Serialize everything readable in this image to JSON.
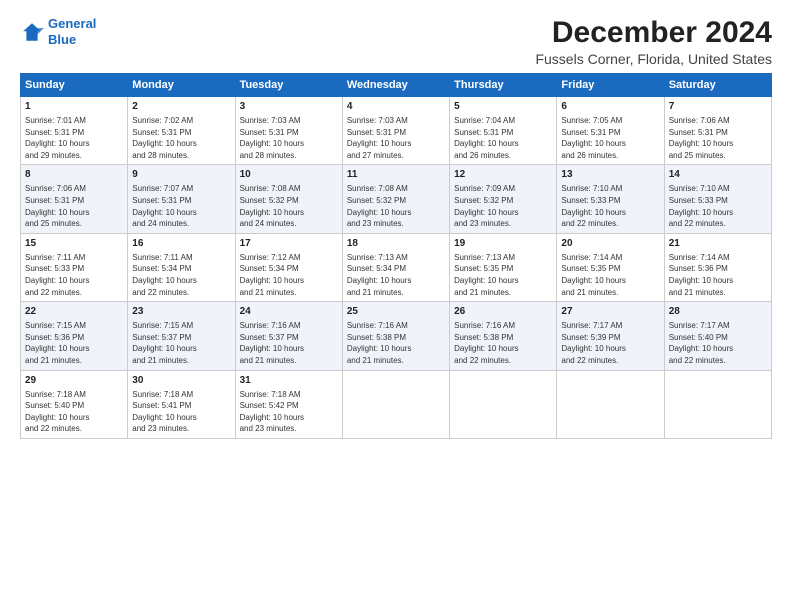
{
  "logo": {
    "line1": "General",
    "line2": "Blue"
  },
  "title": "December 2024",
  "subtitle": "Fussels Corner, Florida, United States",
  "days_header": [
    "Sunday",
    "Monday",
    "Tuesday",
    "Wednesday",
    "Thursday",
    "Friday",
    "Saturday"
  ],
  "weeks": [
    [
      {
        "day": "1",
        "text": "Sunrise: 7:01 AM\nSunset: 5:31 PM\nDaylight: 10 hours\nand 29 minutes."
      },
      {
        "day": "2",
        "text": "Sunrise: 7:02 AM\nSunset: 5:31 PM\nDaylight: 10 hours\nand 28 minutes."
      },
      {
        "day": "3",
        "text": "Sunrise: 7:03 AM\nSunset: 5:31 PM\nDaylight: 10 hours\nand 28 minutes."
      },
      {
        "day": "4",
        "text": "Sunrise: 7:03 AM\nSunset: 5:31 PM\nDaylight: 10 hours\nand 27 minutes."
      },
      {
        "day": "5",
        "text": "Sunrise: 7:04 AM\nSunset: 5:31 PM\nDaylight: 10 hours\nand 26 minutes."
      },
      {
        "day": "6",
        "text": "Sunrise: 7:05 AM\nSunset: 5:31 PM\nDaylight: 10 hours\nand 26 minutes."
      },
      {
        "day": "7",
        "text": "Sunrise: 7:06 AM\nSunset: 5:31 PM\nDaylight: 10 hours\nand 25 minutes."
      }
    ],
    [
      {
        "day": "8",
        "text": "Sunrise: 7:06 AM\nSunset: 5:31 PM\nDaylight: 10 hours\nand 25 minutes."
      },
      {
        "day": "9",
        "text": "Sunrise: 7:07 AM\nSunset: 5:31 PM\nDaylight: 10 hours\nand 24 minutes."
      },
      {
        "day": "10",
        "text": "Sunrise: 7:08 AM\nSunset: 5:32 PM\nDaylight: 10 hours\nand 24 minutes."
      },
      {
        "day": "11",
        "text": "Sunrise: 7:08 AM\nSunset: 5:32 PM\nDaylight: 10 hours\nand 23 minutes."
      },
      {
        "day": "12",
        "text": "Sunrise: 7:09 AM\nSunset: 5:32 PM\nDaylight: 10 hours\nand 23 minutes."
      },
      {
        "day": "13",
        "text": "Sunrise: 7:10 AM\nSunset: 5:33 PM\nDaylight: 10 hours\nand 22 minutes."
      },
      {
        "day": "14",
        "text": "Sunrise: 7:10 AM\nSunset: 5:33 PM\nDaylight: 10 hours\nand 22 minutes."
      }
    ],
    [
      {
        "day": "15",
        "text": "Sunrise: 7:11 AM\nSunset: 5:33 PM\nDaylight: 10 hours\nand 22 minutes."
      },
      {
        "day": "16",
        "text": "Sunrise: 7:11 AM\nSunset: 5:34 PM\nDaylight: 10 hours\nand 22 minutes."
      },
      {
        "day": "17",
        "text": "Sunrise: 7:12 AM\nSunset: 5:34 PM\nDaylight: 10 hours\nand 21 minutes."
      },
      {
        "day": "18",
        "text": "Sunrise: 7:13 AM\nSunset: 5:34 PM\nDaylight: 10 hours\nand 21 minutes."
      },
      {
        "day": "19",
        "text": "Sunrise: 7:13 AM\nSunset: 5:35 PM\nDaylight: 10 hours\nand 21 minutes."
      },
      {
        "day": "20",
        "text": "Sunrise: 7:14 AM\nSunset: 5:35 PM\nDaylight: 10 hours\nand 21 minutes."
      },
      {
        "day": "21",
        "text": "Sunrise: 7:14 AM\nSunset: 5:36 PM\nDaylight: 10 hours\nand 21 minutes."
      }
    ],
    [
      {
        "day": "22",
        "text": "Sunrise: 7:15 AM\nSunset: 5:36 PM\nDaylight: 10 hours\nand 21 minutes."
      },
      {
        "day": "23",
        "text": "Sunrise: 7:15 AM\nSunset: 5:37 PM\nDaylight: 10 hours\nand 21 minutes."
      },
      {
        "day": "24",
        "text": "Sunrise: 7:16 AM\nSunset: 5:37 PM\nDaylight: 10 hours\nand 21 minutes."
      },
      {
        "day": "25",
        "text": "Sunrise: 7:16 AM\nSunset: 5:38 PM\nDaylight: 10 hours\nand 21 minutes."
      },
      {
        "day": "26",
        "text": "Sunrise: 7:16 AM\nSunset: 5:38 PM\nDaylight: 10 hours\nand 22 minutes."
      },
      {
        "day": "27",
        "text": "Sunrise: 7:17 AM\nSunset: 5:39 PM\nDaylight: 10 hours\nand 22 minutes."
      },
      {
        "day": "28",
        "text": "Sunrise: 7:17 AM\nSunset: 5:40 PM\nDaylight: 10 hours\nand 22 minutes."
      }
    ],
    [
      {
        "day": "29",
        "text": "Sunrise: 7:18 AM\nSunset: 5:40 PM\nDaylight: 10 hours\nand 22 minutes."
      },
      {
        "day": "30",
        "text": "Sunrise: 7:18 AM\nSunset: 5:41 PM\nDaylight: 10 hours\nand 23 minutes."
      },
      {
        "day": "31",
        "text": "Sunrise: 7:18 AM\nSunset: 5:42 PM\nDaylight: 10 hours\nand 23 minutes."
      },
      null,
      null,
      null,
      null
    ]
  ]
}
